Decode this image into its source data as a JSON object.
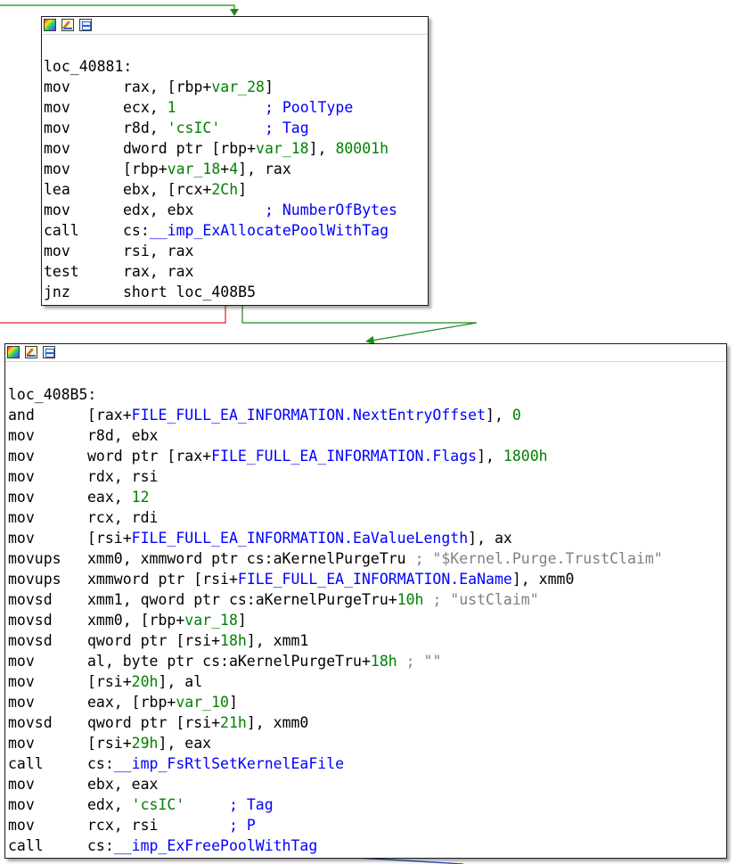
{
  "colors": {
    "text": "#000000",
    "var": "#008000",
    "number": "#008000",
    "string": "#008000",
    "comment": "#0000ff",
    "symbol": "#0000ff",
    "string_comment": "#808080",
    "edge_true": "#1a8a1a",
    "edge_false": "#e02020",
    "edge_normal": "#2040c0"
  },
  "titlebar_icons": [
    "color-palette-icon",
    "edit-pencil-icon",
    "graph-overview-icon"
  ],
  "block1": {
    "label": "loc_40881:",
    "lines": [
      {
        "m": "mov",
        "t": [
          {
            "c": "t-op",
            "v": "rax, [rbp+"
          },
          {
            "c": "t-var",
            "v": "var_28"
          },
          {
            "c": "t-op",
            "v": "]"
          }
        ]
      },
      {
        "m": "mov",
        "t": [
          {
            "c": "t-op",
            "v": "ecx, "
          },
          {
            "c": "t-num",
            "v": "1"
          },
          {
            "c": "t-op",
            "v": "          "
          },
          {
            "c": "t-cmt",
            "v": "; PoolType"
          }
        ]
      },
      {
        "m": "mov",
        "t": [
          {
            "c": "t-op",
            "v": "r8d, "
          },
          {
            "c": "t-str",
            "v": "'csIC'"
          },
          {
            "c": "t-op",
            "v": "     "
          },
          {
            "c": "t-cmt",
            "v": "; Tag"
          }
        ]
      },
      {
        "m": "mov",
        "t": [
          {
            "c": "t-op",
            "v": "dword ptr [rbp+"
          },
          {
            "c": "t-var",
            "v": "var_18"
          },
          {
            "c": "t-op",
            "v": "], "
          },
          {
            "c": "t-num",
            "v": "80001h"
          }
        ]
      },
      {
        "m": "mov",
        "t": [
          {
            "c": "t-op",
            "v": "[rbp+"
          },
          {
            "c": "t-var",
            "v": "var_18"
          },
          {
            "c": "t-op",
            "v": "+"
          },
          {
            "c": "t-num",
            "v": "4"
          },
          {
            "c": "t-op",
            "v": "], rax"
          }
        ]
      },
      {
        "m": "lea",
        "t": [
          {
            "c": "t-op",
            "v": "ebx, [rcx+"
          },
          {
            "c": "t-num",
            "v": "2Ch"
          },
          {
            "c": "t-op",
            "v": "]"
          }
        ]
      },
      {
        "m": "mov",
        "t": [
          {
            "c": "t-op",
            "v": "edx, ebx        "
          },
          {
            "c": "t-cmt",
            "v": "; NumberOfBytes"
          }
        ]
      },
      {
        "m": "call",
        "t": [
          {
            "c": "t-op",
            "v": "cs:"
          },
          {
            "c": "t-sym",
            "v": "__imp_ExAllocatePoolWithTag"
          }
        ]
      },
      {
        "m": "mov",
        "t": [
          {
            "c": "t-op",
            "v": "rsi, rax"
          }
        ]
      },
      {
        "m": "test",
        "t": [
          {
            "c": "t-op",
            "v": "rax, rax"
          }
        ]
      },
      {
        "m": "jnz",
        "t": [
          {
            "c": "t-op",
            "v": "short loc_408B5"
          }
        ]
      }
    ]
  },
  "block2": {
    "label": "loc_408B5:",
    "lines": [
      {
        "m": "and",
        "t": [
          {
            "c": "t-op",
            "v": "[rax+"
          },
          {
            "c": "t-sym",
            "v": "FILE_FULL_EA_INFORMATION.NextEntryOffset"
          },
          {
            "c": "t-op",
            "v": "], "
          },
          {
            "c": "t-num",
            "v": "0"
          }
        ]
      },
      {
        "m": "mov",
        "t": [
          {
            "c": "t-op",
            "v": "r8d, ebx"
          }
        ]
      },
      {
        "m": "mov",
        "t": [
          {
            "c": "t-op",
            "v": "word ptr [rax+"
          },
          {
            "c": "t-sym",
            "v": "FILE_FULL_EA_INFORMATION.Flags"
          },
          {
            "c": "t-op",
            "v": "], "
          },
          {
            "c": "t-num",
            "v": "1800h"
          }
        ]
      },
      {
        "m": "mov",
        "t": [
          {
            "c": "t-op",
            "v": "rdx, rsi"
          }
        ]
      },
      {
        "m": "mov",
        "t": [
          {
            "c": "t-op",
            "v": "eax, "
          },
          {
            "c": "t-num",
            "v": "12"
          }
        ]
      },
      {
        "m": "mov",
        "t": [
          {
            "c": "t-op",
            "v": "rcx, rdi"
          }
        ]
      },
      {
        "m": "mov",
        "t": [
          {
            "c": "t-op",
            "v": "[rsi+"
          },
          {
            "c": "t-sym",
            "v": "FILE_FULL_EA_INFORMATION.EaValueLength"
          },
          {
            "c": "t-op",
            "v": "], ax"
          }
        ]
      },
      {
        "m": "movups",
        "t": [
          {
            "c": "t-op",
            "v": "xmm0, xmmword ptr cs:aKernelPurgeTru "
          },
          {
            "c": "t-strcmt",
            "v": "; \"$Kernel.Purge.TrustClaim\""
          }
        ]
      },
      {
        "m": "movups",
        "t": [
          {
            "c": "t-op",
            "v": "xmmword ptr [rsi+"
          },
          {
            "c": "t-sym",
            "v": "FILE_FULL_EA_INFORMATION.EaName"
          },
          {
            "c": "t-op",
            "v": "], xmm0"
          }
        ]
      },
      {
        "m": "movsd",
        "t": [
          {
            "c": "t-op",
            "v": "xmm1, qword ptr cs:aKernelPurgeTru+"
          },
          {
            "c": "t-num",
            "v": "10h"
          },
          {
            "c": "t-op",
            "v": " "
          },
          {
            "c": "t-strcmt",
            "v": "; \"ustClaim\""
          }
        ]
      },
      {
        "m": "movsd",
        "t": [
          {
            "c": "t-op",
            "v": "xmm0, [rbp+"
          },
          {
            "c": "t-var",
            "v": "var_18"
          },
          {
            "c": "t-op",
            "v": "]"
          }
        ]
      },
      {
        "m": "movsd",
        "t": [
          {
            "c": "t-op",
            "v": "qword ptr [rsi+"
          },
          {
            "c": "t-num",
            "v": "18h"
          },
          {
            "c": "t-op",
            "v": "], xmm1"
          }
        ]
      },
      {
        "m": "mov",
        "t": [
          {
            "c": "t-op",
            "v": "al, byte ptr cs:aKernelPurgeTru+"
          },
          {
            "c": "t-num",
            "v": "18h"
          },
          {
            "c": "t-op",
            "v": " "
          },
          {
            "c": "t-strcmt",
            "v": "; \"\""
          }
        ]
      },
      {
        "m": "mov",
        "t": [
          {
            "c": "t-op",
            "v": "[rsi+"
          },
          {
            "c": "t-num",
            "v": "20h"
          },
          {
            "c": "t-op",
            "v": "], al"
          }
        ]
      },
      {
        "m": "mov",
        "t": [
          {
            "c": "t-op",
            "v": "eax, [rbp+"
          },
          {
            "c": "t-var",
            "v": "var_10"
          },
          {
            "c": "t-op",
            "v": "]"
          }
        ]
      },
      {
        "m": "movsd",
        "t": [
          {
            "c": "t-op",
            "v": "qword ptr [rsi+"
          },
          {
            "c": "t-num",
            "v": "21h"
          },
          {
            "c": "t-op",
            "v": "], xmm0"
          }
        ]
      },
      {
        "m": "mov",
        "t": [
          {
            "c": "t-op",
            "v": "[rsi+"
          },
          {
            "c": "t-num",
            "v": "29h"
          },
          {
            "c": "t-op",
            "v": "], eax"
          }
        ]
      },
      {
        "m": "call",
        "t": [
          {
            "c": "t-op",
            "v": "cs:"
          },
          {
            "c": "t-sym",
            "v": "__imp_FsRtlSetKernelEaFile"
          }
        ]
      },
      {
        "m": "mov",
        "t": [
          {
            "c": "t-op",
            "v": "ebx, eax"
          }
        ]
      },
      {
        "m": "mov",
        "t": [
          {
            "c": "t-op",
            "v": "edx, "
          },
          {
            "c": "t-str",
            "v": "'csIC'"
          },
          {
            "c": "t-op",
            "v": "     "
          },
          {
            "c": "t-cmt",
            "v": "; Tag"
          }
        ]
      },
      {
        "m": "mov",
        "t": [
          {
            "c": "t-op",
            "v": "rcx, rsi        "
          },
          {
            "c": "t-cmt",
            "v": "; P"
          }
        ]
      },
      {
        "m": "call",
        "t": [
          {
            "c": "t-op",
            "v": "cs:"
          },
          {
            "c": "t-sym",
            "v": "__imp_ExFreePoolWithTag"
          }
        ]
      }
    ]
  }
}
